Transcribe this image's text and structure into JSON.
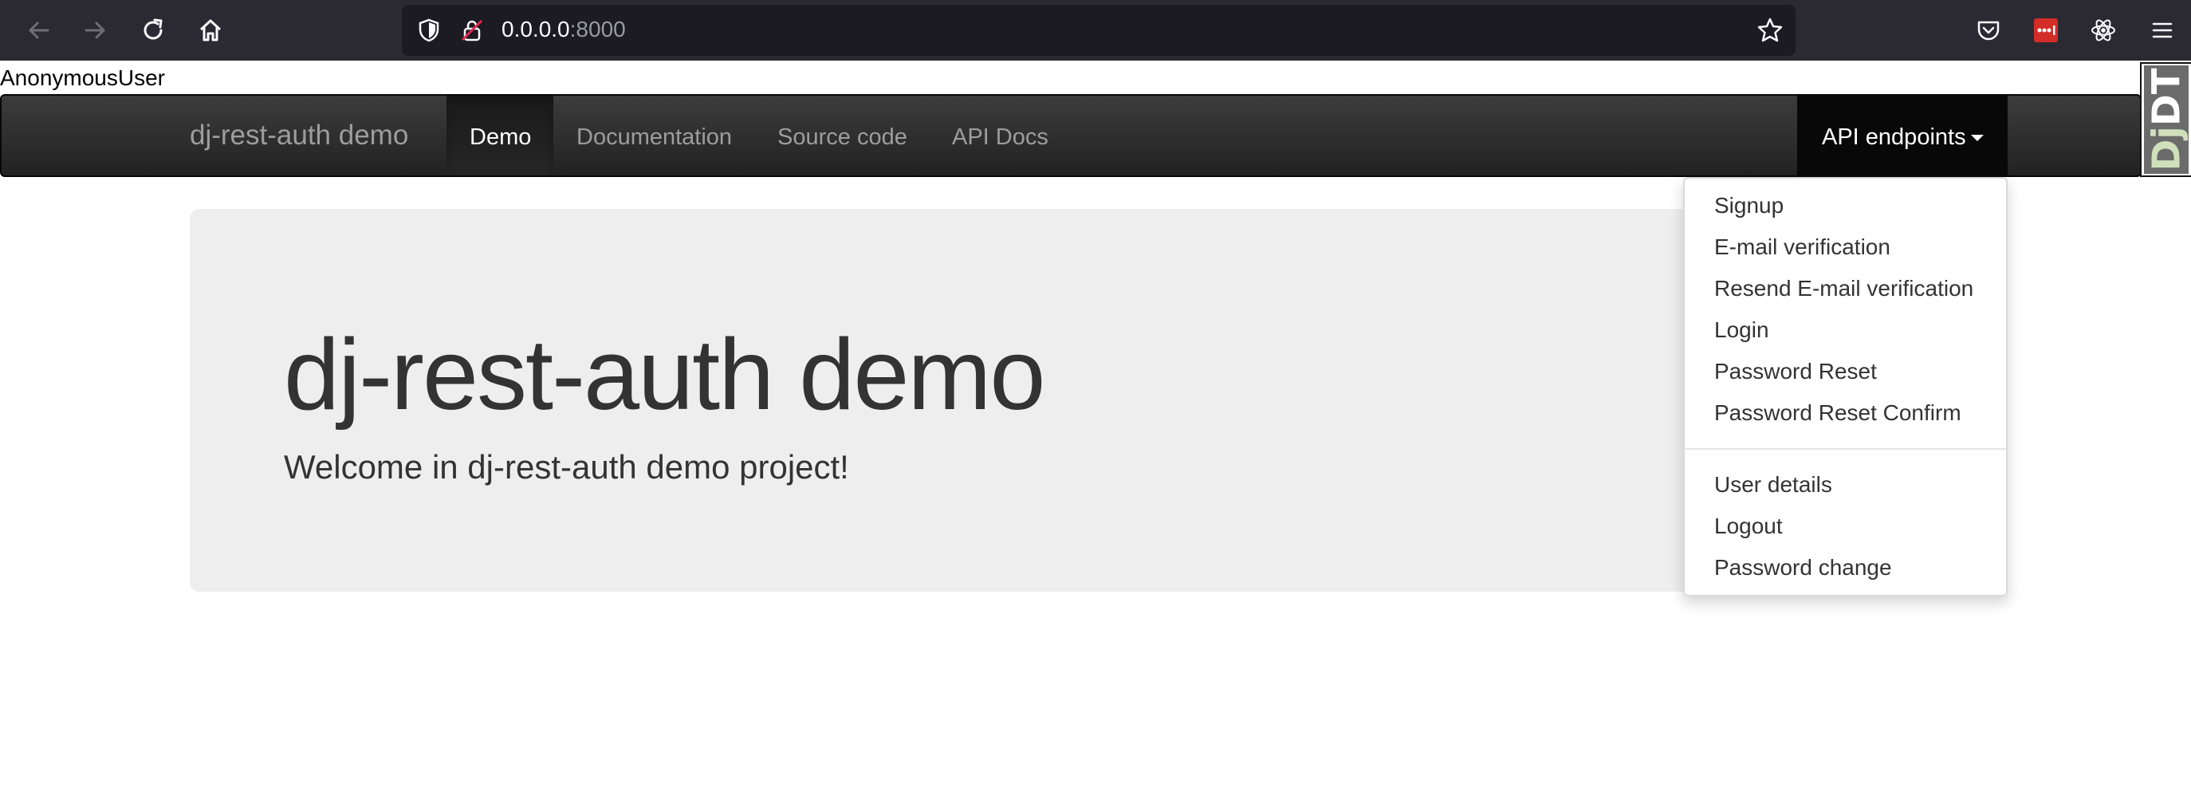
{
  "browser": {
    "url_host": "0.0.0.0",
    "url_port": ":8000",
    "icons": {
      "back": "back-arrow-icon",
      "forward": "forward-arrow-icon",
      "reload": "reload-icon",
      "home": "home-icon",
      "shield": "tracking-shield-icon",
      "lock": "insecure-lock-icon",
      "bookmark": "bookmark-star-icon",
      "pocket": "pocket-icon",
      "extension": "lastpass-icon",
      "react": "react-devtools-icon",
      "menu": "hamburger-menu-icon"
    }
  },
  "user": {
    "label": "AnonymousUser"
  },
  "navbar": {
    "brand": "dj-rest-auth demo",
    "links": [
      {
        "label": "Demo",
        "active": true
      },
      {
        "label": "Documentation",
        "active": false
      },
      {
        "label": "Source code",
        "active": false
      },
      {
        "label": "API Docs",
        "active": false
      }
    ],
    "api_dropdown": {
      "label": "API endpoints",
      "group1": [
        "Signup",
        "E-mail verification",
        "Resend E-mail verification",
        "Login",
        "Password Reset",
        "Password Reset Confirm"
      ],
      "group2": [
        "User details",
        "Logout",
        "Password change"
      ]
    }
  },
  "jumbotron": {
    "title": "dj-rest-auth demo",
    "subtitle": "Welcome in dj-rest-auth demo project!"
  },
  "debug_toolbar": {
    "prefix": "Dj",
    "suffix": "DT"
  },
  "colors": {
    "navbar_bg": "#222222",
    "jumbotron_bg": "#eeeeee",
    "browser_chrome": "#2b2a33",
    "urlbar_bg": "#1c1b22"
  }
}
